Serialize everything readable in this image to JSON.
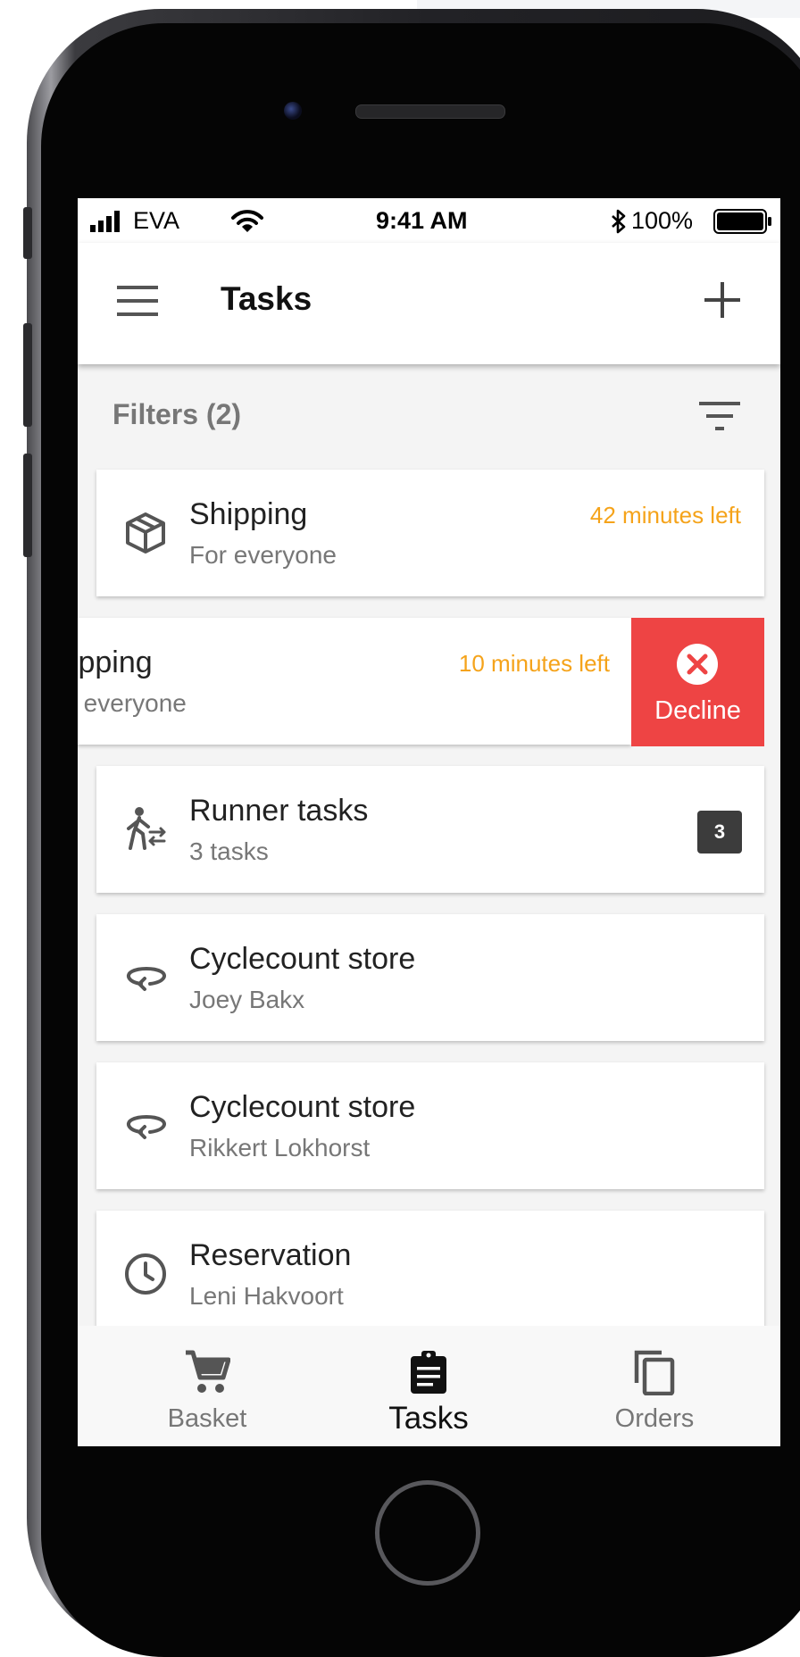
{
  "status_bar": {
    "carrier": "EVA",
    "time": "9:41 AM",
    "battery": "100%"
  },
  "app_bar": {
    "title": "Tasks",
    "menu_icon": "hamburger-menu-icon",
    "add_icon": "plus-icon"
  },
  "filters": {
    "label": "Filters (2)",
    "icon": "filter-list-icon"
  },
  "tasks": [
    {
      "title": "Shipping",
      "subtitle": "For everyone",
      "time_left": "42 minutes left",
      "icon": "package-box-icon"
    },
    {
      "title": "hipping",
      "subtitle": "or everyone",
      "time_left": "10 minutes left",
      "swiped": true,
      "action_label": "Decline",
      "action_icon": "close-circle-icon"
    },
    {
      "title": "Runner tasks",
      "subtitle": "3 tasks",
      "badge": "3",
      "icon": "runner-transfer-icon"
    },
    {
      "title": "Cyclecount store",
      "subtitle": "Joey Bakx",
      "icon": "cycle-arrow-icon"
    },
    {
      "title": "Cyclecount store",
      "subtitle": "Rikkert Lokhorst",
      "icon": "cycle-arrow-icon"
    },
    {
      "title": "Reservation",
      "subtitle": "Leni Hakvoort",
      "icon": "clock-icon"
    }
  ],
  "bottom_nav": [
    {
      "label": "Basket",
      "icon": "shopping-cart-icon",
      "active": false
    },
    {
      "label": "Tasks",
      "icon": "clipboard-icon",
      "active": true
    },
    {
      "label": "Orders",
      "icon": "copy-orders-icon",
      "active": false
    }
  ],
  "colors": {
    "warning_text": "#f5a31a",
    "decline_bg": "#ee4444",
    "badge_bg": "#3c3c3c",
    "screen_bg": "#f4f4f4"
  }
}
